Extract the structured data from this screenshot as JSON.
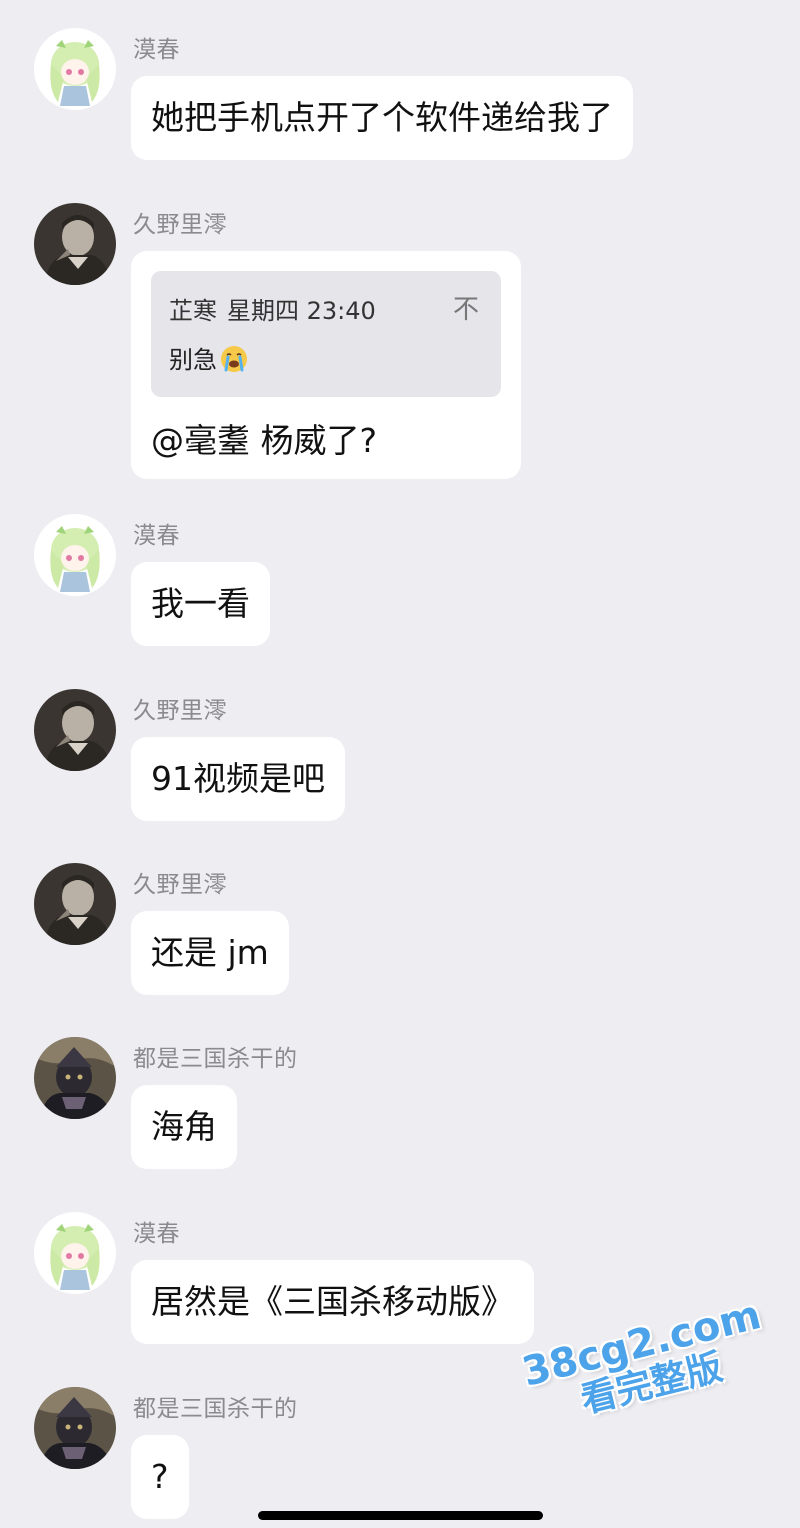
{
  "messages": [
    {
      "sender": "漠春",
      "avatar": "anime-girl",
      "text": "她把手机点开了个软件递给我了"
    },
    {
      "sender": "久野里澪",
      "avatar": "bw-portrait",
      "quote": {
        "author": "芷寒",
        "time": "星期四 23:40",
        "text": "别急",
        "emoji": "crying-face-emoji",
        "arrow": "不"
      },
      "text": "@毫耋 杨威了?"
    },
    {
      "sender": "漠春",
      "avatar": "anime-girl",
      "text": "我一看"
    },
    {
      "sender": "久野里澪",
      "avatar": "bw-portrait",
      "text": "91视频是吧"
    },
    {
      "sender": "久野里澪",
      "avatar": "bw-portrait",
      "text": "还是 jm"
    },
    {
      "sender": "都是三国杀干的",
      "avatar": "dark-warrior",
      "text": "海角"
    },
    {
      "sender": "漠春",
      "avatar": "anime-girl",
      "text": "居然是《三国杀移动版》"
    },
    {
      "sender": "都是三国杀干的",
      "avatar": "dark-warrior",
      "text": "?"
    }
  ],
  "watermark": {
    "line1": "38cg2.com",
    "line2": "看完整版"
  },
  "colors": {
    "background": "#ededf2",
    "bubble": "#ffffff",
    "quote": "#e5e5ea",
    "sender": "#8a8a8f",
    "watermark": "#4da3ea"
  }
}
